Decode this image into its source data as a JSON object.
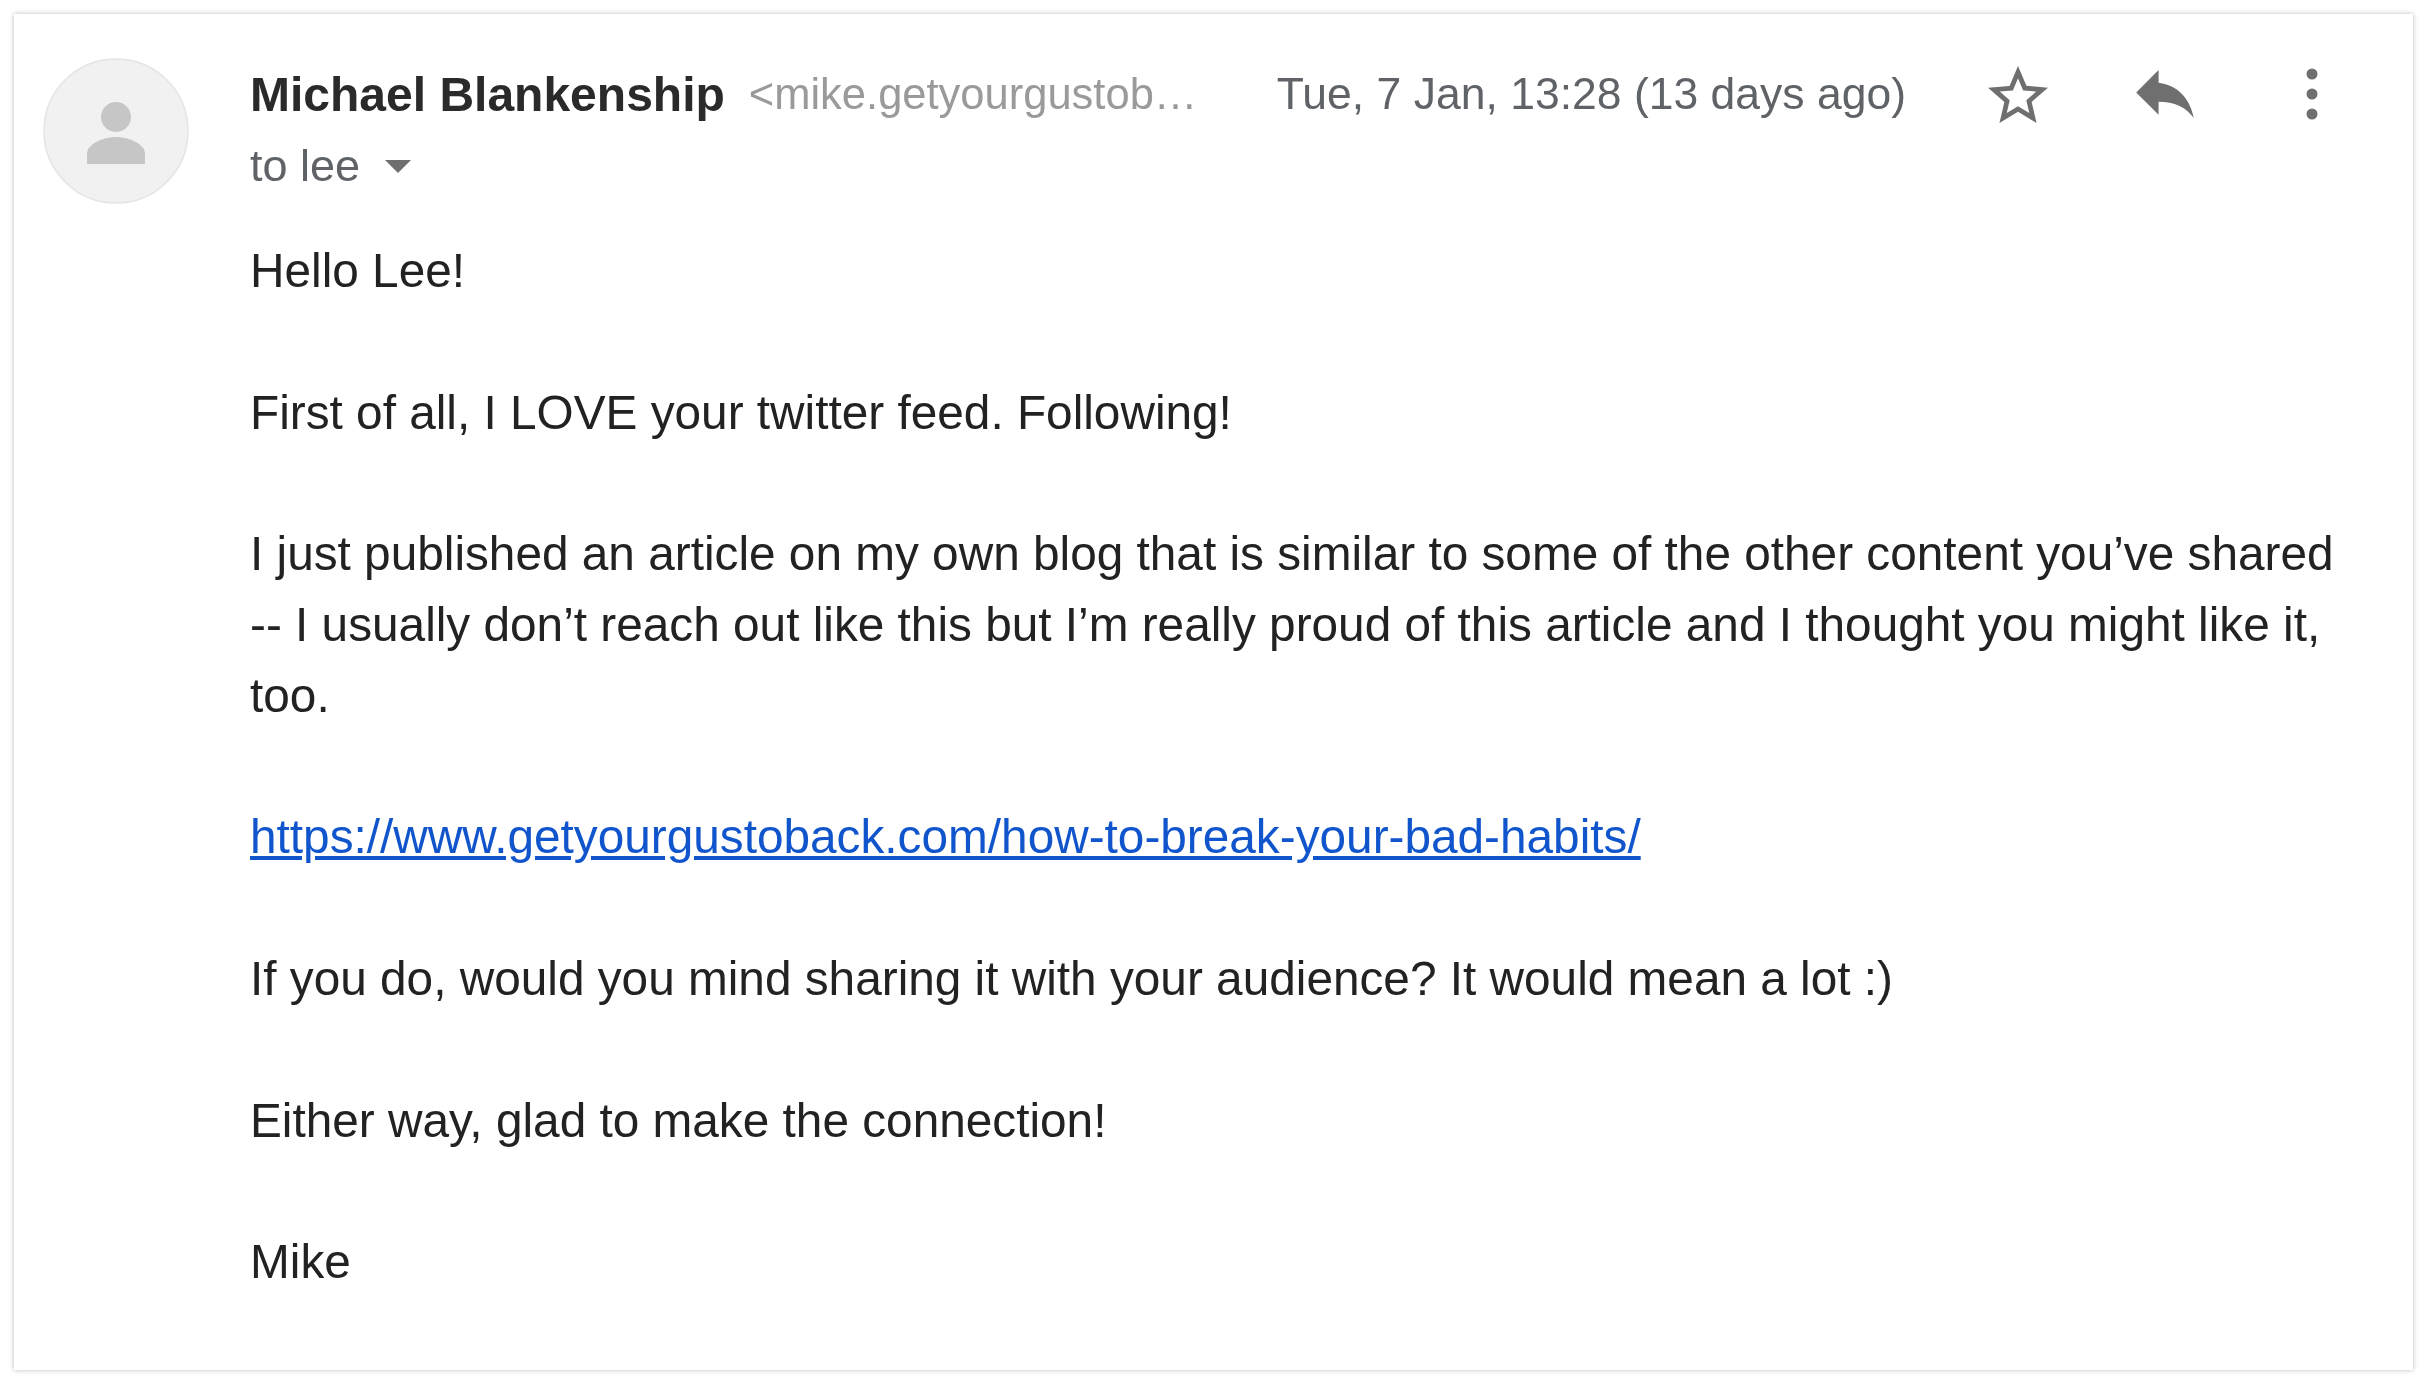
{
  "email": {
    "sender": {
      "name": "Michael Blankenship",
      "address": "<mike.getyourgustob…"
    },
    "recipient": "to lee",
    "date": "Tue, 7 Jan, 13:28 (13 days ago)",
    "starred": false
  },
  "body": [
    {
      "kind": "text",
      "text": "Hello Lee!"
    },
    {
      "kind": "text",
      "text": "First of all, I LOVE your twitter feed. Following!"
    },
    {
      "kind": "text",
      "text": "I just published an article on my own blog that is similar to some of the other content you’ve shared -- I usually don’t reach out like this but I’m really proud of this article and I thought you might like it, too."
    },
    {
      "kind": "link",
      "text": "https://www.getyourgustoback.com/how-to-break-your-bad-habits/"
    },
    {
      "kind": "text",
      "text": "If you do, would you mind sharing it with your audience? It would mean a lot :)"
    },
    {
      "kind": "text",
      "text": "Either way, glad to make the connection!"
    },
    {
      "kind": "text",
      "text": "Mike"
    }
  ]
}
